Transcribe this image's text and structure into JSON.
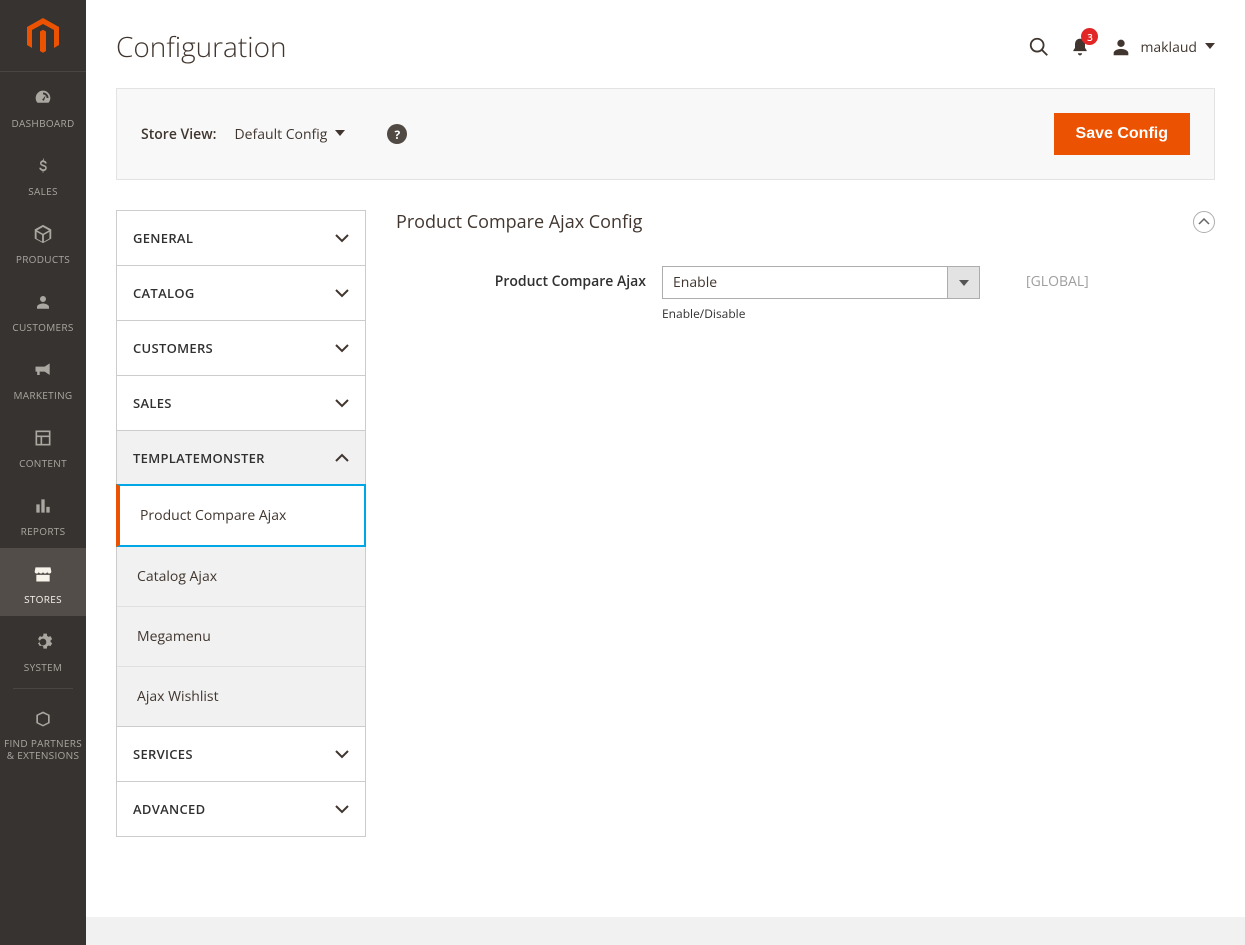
{
  "page": {
    "title": "Configuration"
  },
  "header": {
    "notification_count": "3",
    "user_name": "maklaud"
  },
  "toolbar": {
    "store_view_label": "Store View:",
    "store_view_value": "Default Config",
    "save_label": "Save Config"
  },
  "nav": {
    "dashboard": "DASHBOARD",
    "sales": "SALES",
    "products": "PRODUCTS",
    "customers": "CUSTOMERS",
    "marketing": "MARKETING",
    "content": "CONTENT",
    "reports": "REPORTS",
    "stores": "STORES",
    "system": "SYSTEM",
    "partners": "FIND PARTNERS & EXTENSIONS"
  },
  "config_sections": {
    "general": "GENERAL",
    "catalog": "CATALOG",
    "customers": "CUSTOMERS",
    "sales": "SALES",
    "templatemonster": "TEMPLATEMONSTER",
    "services": "SERVICES",
    "advanced": "ADVANCED"
  },
  "tm_subitems": {
    "product_compare_ajax": "Product Compare Ajax",
    "catalog_ajax": "Catalog Ajax",
    "megamenu": "Megamenu",
    "ajax_wishlist": "Ajax Wishlist"
  },
  "panel": {
    "title": "Product Compare Ajax Config",
    "field_label": "Product Compare Ajax",
    "field_value": "Enable",
    "field_note": "Enable/Disable",
    "field_scope": "[GLOBAL]"
  }
}
